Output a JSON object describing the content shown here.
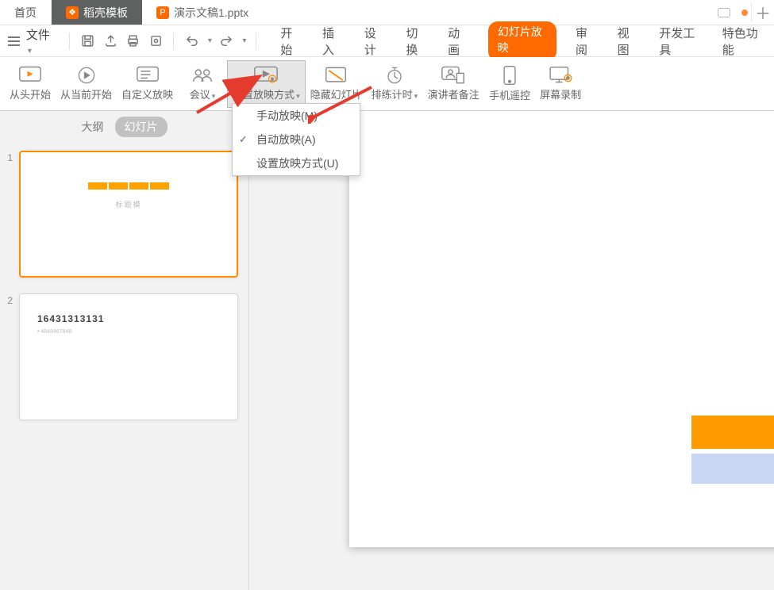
{
  "tabs": {
    "home": "首页",
    "templates": "稻壳模板",
    "document": "演示文稿1.pptx"
  },
  "fileMenu": {
    "label": "文件"
  },
  "ribbon": {
    "start": "开始",
    "insert": "插入",
    "design": "设计",
    "transition": "切换",
    "animation": "动画",
    "slideshow": "幻灯片放映",
    "review": "审阅",
    "view": "视图",
    "devtools": "开发工具",
    "special": "特色功能"
  },
  "toolbar": {
    "from_start": "从头开始",
    "from_current": "从当前开始",
    "custom_show": "自定义放映",
    "meeting": "会议",
    "setup_show": "设置放映方式",
    "hide_slide": "隐藏幻灯片",
    "rehearse": "排练计时",
    "presenter_notes": "演讲者备注",
    "phone_remote": "手机遥控",
    "screen_record": "屏幕录制"
  },
  "dropdown": {
    "manual": "手动放映(M)",
    "auto": "自动放映(A)",
    "settings": "设置放映方式(U)"
  },
  "panel": {
    "outline": "大纲",
    "slides": "幻灯片",
    "slide1_caption": "标题模",
    "slide2_title": "16431313131",
    "slide2_sub": "• 4848467848",
    "num1": "1",
    "num2": "2"
  }
}
